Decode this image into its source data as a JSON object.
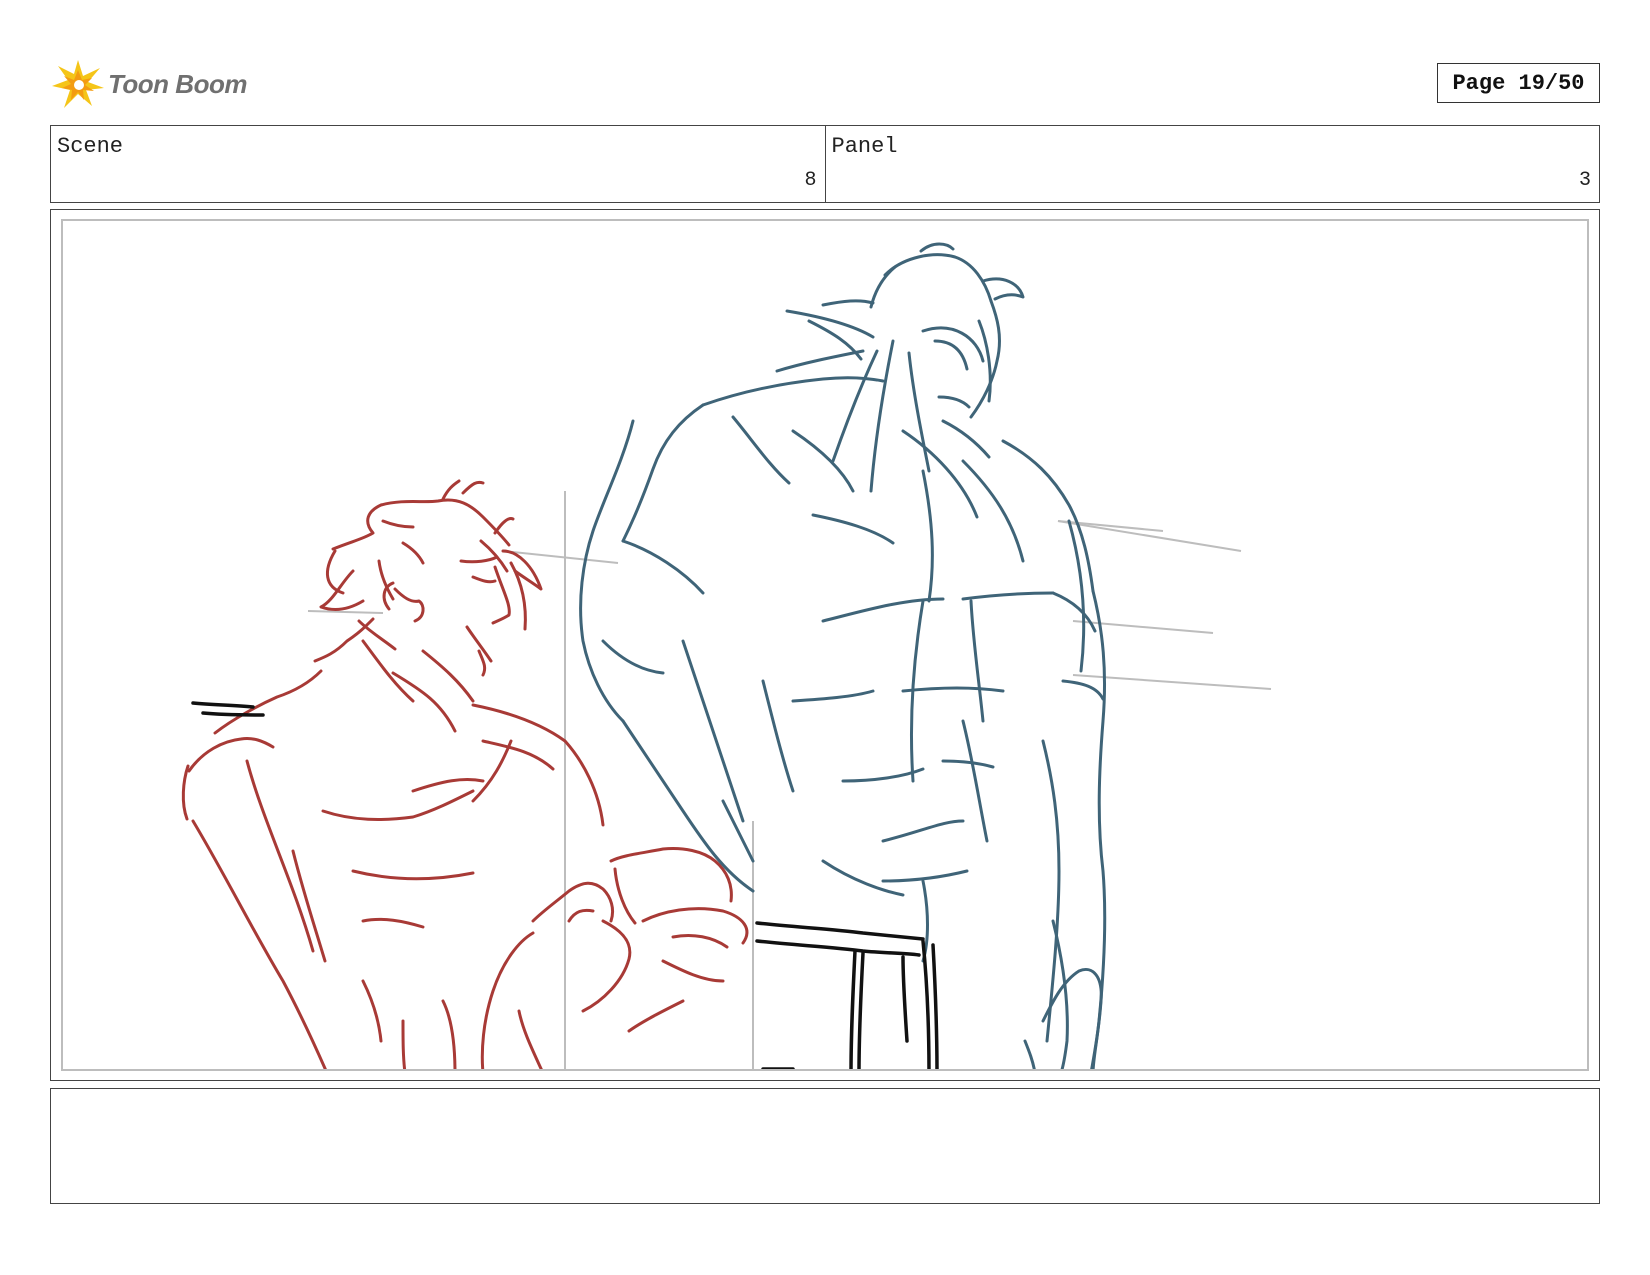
{
  "header": {
    "logo_text": "Toon Boom",
    "page_label": "Page 19/50"
  },
  "info": {
    "scene_label": "Scene",
    "scene_value": "8",
    "panel_label": "Panel",
    "panel_value": "3"
  },
  "panel": {
    "ink_colors": {
      "seated_character": "#a83a36",
      "standing_character": "#3f6478",
      "props": "#111111",
      "guides": "#bdbdbd"
    }
  },
  "notes": {
    "text": ""
  }
}
